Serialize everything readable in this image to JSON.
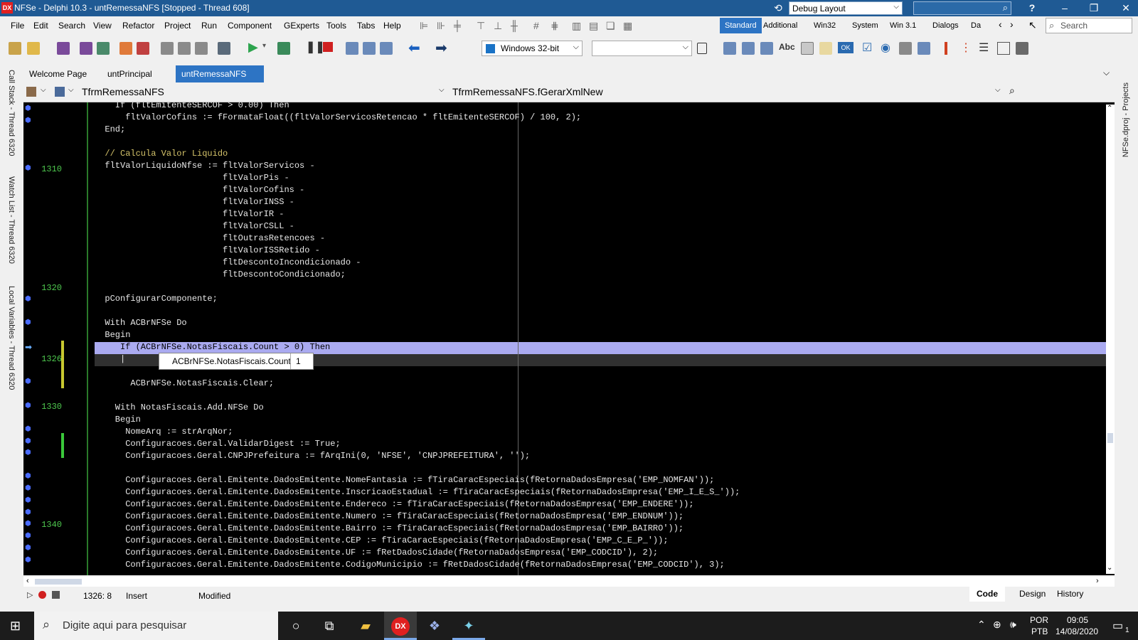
{
  "window": {
    "title": "NFSe - Delphi 10.3 - untRemessaNFS [Stopped - Thread 608]",
    "logo_text": "DX",
    "layout": "Debug Layout",
    "help": "?"
  },
  "menu": [
    "File",
    "Edit",
    "Search",
    "View",
    "Refactor",
    "Project",
    "Run",
    "Component",
    "GExperts",
    "Tools",
    "Tabs",
    "Help"
  ],
  "palette_tabs": [
    "Standard",
    "Additional",
    "Win32",
    "System",
    "Win 3.1",
    "Dialogs",
    "Da"
  ],
  "ide_search": {
    "placeholder": "Search"
  },
  "toolbar": {
    "platform": "Windows 32-bit"
  },
  "docks": {
    "left": [
      "Call Stack - Thread 6320",
      "Watch List - Thread 6320",
      "Local Variables - Thread 6320"
    ],
    "right": [
      "NFSe.dproj - Projects"
    ]
  },
  "tabs": [
    {
      "label": "Welcome Page"
    },
    {
      "label": "untPrincipal"
    },
    {
      "label": "untRemessaNFS",
      "active": true
    }
  ],
  "navbar": {
    "class": "TfrmRemessaNFS",
    "method": "TfrmRemessaNFS.fGerarXmlNew"
  },
  "gutter_numbers": [
    "1310",
    "1320",
    "1326",
    "1330",
    "1340"
  ],
  "code": [
    "    If (fltEmitenteSERCOF > 0.00) Then",
    "      fltValorCofins := fFormataFloat((fltValorServicosRetencao * fltEmitenteSERCOF) / 100, 2);",
    "  End;",
    "",
    "  // Calcula Valor Liquido",
    "  fltValorLiquidoNfse := fltValorServicos -",
    "                         fltValorPis -",
    "                         fltValorCofins -",
    "                         fltValorINSS -",
    "                         fltValorIR -",
    "                         fltValorCSLL -",
    "                         fltOutrasRetencoes -",
    "                         fltValorISSRetido -",
    "                         fltDescontoIncondicionado -",
    "                         fltDescontoCondicionado;",
    "",
    "  pConfigurarComponente;",
    "",
    "  With ACBrNFSe Do",
    "  Begin",
    "     If (ACBrNFSe.NotasFiscais.Count > 0) Then",
    "     |",
    "",
    "       ACBrNFSe.NotasFiscais.Clear;",
    "",
    "    With NotasFiscais.Add.NFSe Do",
    "    Begin",
    "      NomeArq := strArqNor;",
    "      Configuracoes.Geral.ValidarDigest := True;",
    "      Configuracoes.Geral.CNPJPrefeitura := fArqIni(0, 'NFSE', 'CNPJPREFEITURA', '');",
    "",
    "      Configuracoes.Geral.Emitente.DadosEmitente.NomeFantasia := fTiraCaracEspeciais(fRetornaDadosEmpresa('EMP_NOMFAN'));",
    "      Configuracoes.Geral.Emitente.DadosEmitente.InscricaoEstadual := fTiraCaracEspeciais(fRetornaDadosEmpresa('EMP_I_E_S_'));",
    "      Configuracoes.Geral.Emitente.DadosEmitente.Endereco := fTiraCaracEspeciais(fRetornaDadosEmpresa('EMP_ENDERE'));",
    "      Configuracoes.Geral.Emitente.DadosEmitente.Numero := fTiraCaracEspeciais(fRetornaDadosEmpresa('EMP_ENDNUM'));",
    "      Configuracoes.Geral.Emitente.DadosEmitente.Bairro := fTiraCaracEspeciais(fRetornaDadosEmpresa('EMP_BAIRRO'));",
    "      Configuracoes.Geral.Emitente.DadosEmitente.CEP := fTiraCaracEspeciais(fRetornaDadosEmpresa('EMP_C_E_P_'));",
    "      Configuracoes.Geral.Emitente.DadosEmitente.UF := fRetDadosCidade(fRetornaDadosEmpresa('EMP_CODCID'), 2);",
    "      Configuracoes.Geral.Emitente.DadosEmitente.CodigoMunicipio := fRetDadosCidade(fRetornaDadosEmpresa('EMP_CODCID'), 3);"
  ],
  "debug_tooltip": {
    "expression": "ACBrNFSe.NotasFiscais.Count",
    "value": "1"
  },
  "status": {
    "position": "1326:  8",
    "mode": "Insert",
    "state": "Modified",
    "views": [
      "Code",
      "Design",
      "History"
    ]
  },
  "taskbar": {
    "search_placeholder": "Digite aqui para pesquisar",
    "lang": "POR",
    "lang2": "PTB",
    "time": "09:05",
    "date": "14/08/2020",
    "notifications": "1"
  }
}
